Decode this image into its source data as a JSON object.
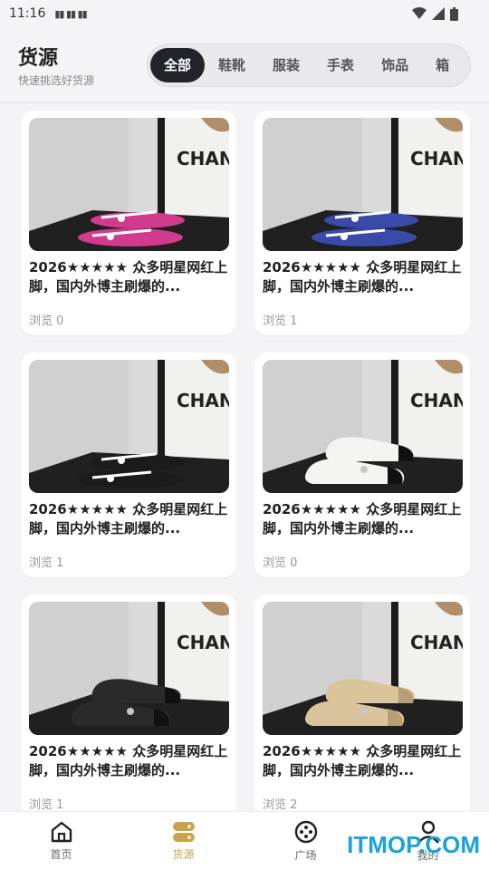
{
  "status_bar": {
    "time": "11:16",
    "indicators": "▮▮ ▮▮ ▮▮"
  },
  "header": {
    "title": "货源",
    "subtitle": "快速挑选好货源",
    "tabs": [
      "全部",
      "鞋靴",
      "服装",
      "手表",
      "饰品",
      "箱"
    ],
    "active_tab": "全部"
  },
  "products": [
    {
      "title": "2026★★★★★ 众多明星网红上脚，国内外博主刷爆的...",
      "views": "浏览 0",
      "image_colors": {
        "shoe": "#d23a8e",
        "accent": "#ffffff",
        "kind": "sandal"
      }
    },
    {
      "title": "2026★★★★★ 众多明星网红上脚，国内外博主刷爆的...",
      "views": "浏览 1",
      "image_colors": {
        "shoe": "#3a4aa8",
        "accent": "#ffffff",
        "kind": "sandal"
      }
    },
    {
      "title": "2026★★★★★ 众多明星网红上脚，国内外博主刷爆的...",
      "views": "浏览 1",
      "image_colors": {
        "shoe": "#1b1b1b",
        "accent": "#ffffff",
        "kind": "sandal"
      }
    },
    {
      "title": "2026★★★★★ 众多明星网红上脚，国内外博主刷爆的...",
      "views": "浏览 0",
      "image_colors": {
        "shoe": "#f4f4f2",
        "accent": "#111111",
        "kind": "flat"
      }
    },
    {
      "title": "2026★★★★★ 众多明星网红上脚，国内外博主刷爆的...",
      "views": "浏览 1",
      "image_colors": {
        "shoe": "#2a2a2a",
        "accent": "#111111",
        "kind": "flat"
      }
    },
    {
      "title": "2026★★★★★ 众多明星网红上脚，国内外博主刷爆的...",
      "views": "浏览 2",
      "image_colors": {
        "shoe": "#d9c49c",
        "accent": "#b79f74",
        "kind": "flat"
      }
    }
  ],
  "photo_sign_text": "CHAN",
  "bottom_nav": [
    {
      "label": "首页",
      "icon": "home-icon",
      "active": false
    },
    {
      "label": "货源",
      "icon": "database-icon",
      "active": true
    },
    {
      "label": "广场",
      "icon": "plaza-icon",
      "active": false
    },
    {
      "label": "我的",
      "icon": "user-icon",
      "active": false
    }
  ],
  "watermark": "ITMOP.COM",
  "colors": {
    "accent": "#c9a34a",
    "tab_active_bg": "#23232b"
  }
}
